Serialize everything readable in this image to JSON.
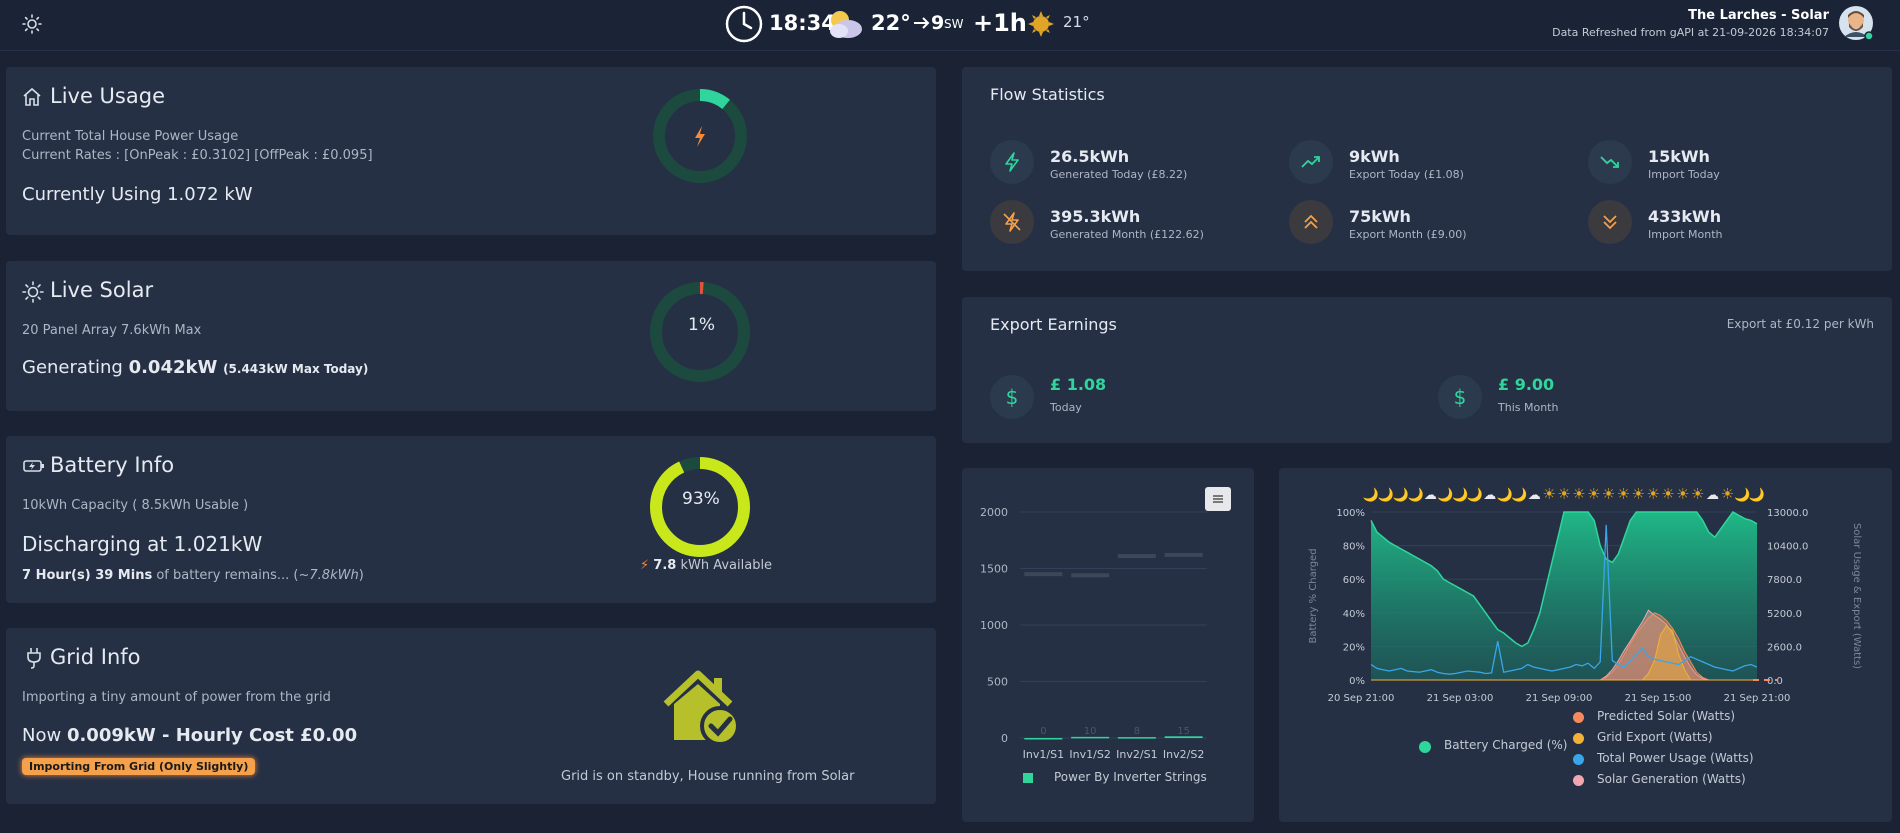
{
  "header": {
    "time": "18:34",
    "temp": "22°",
    "wind_speed": "9",
    "wind_dir": "SW",
    "hour_offset": "+1h",
    "sun_temp": "21°",
    "site_name": "The Larches - Solar",
    "refresh_text": "Data Refreshed from gAPI at 21-09-2026 18:34:07"
  },
  "icons": [
    "sun-icon",
    "clock-icon",
    "cloud-night-icon",
    "arrow-right-icon",
    "sun-weather-icon",
    "avatar",
    "home-icon",
    "solar-icon",
    "battery-icon",
    "plug-icon",
    "bolt-icon",
    "trend-up-icon",
    "trend-down-icon",
    "bolt-off-icon",
    "double-up-icon",
    "double-down-icon",
    "dollar-icon",
    "menu-icon",
    "house-check-icon"
  ],
  "live_usage": {
    "title": "Live Usage",
    "desc": "Current Total House Power Usage",
    "rates": "Current Rates : [OnPeak : £0.3102] [OffPeak : £0.095]",
    "current": "Currently Using 1.072 kW",
    "gauge_fraction": 0.11
  },
  "live_solar": {
    "title": "Live Solar",
    "desc": "20 Panel Array 7.6kWh Max",
    "gen_prefix": "Generating",
    "gen_value": "0.042kW",
    "gen_max": "(5.443kW Max Today)",
    "gauge_label": "1%",
    "gauge_fraction": 0.01
  },
  "battery": {
    "title": "Battery Info",
    "capacity": "10kWh Capacity ( 8.5kWh Usable )",
    "status": "Discharging at 1.021kW",
    "remain_bold": "7 Hour(s) 39 Mins",
    "remain_rest": "of battery remains... (~",
    "remain_est": "7.8kWh",
    "remain_close": ")",
    "gauge_label": "93%",
    "gauge_fraction": 0.93,
    "available_value": "7.8",
    "available_label": "kWh Available"
  },
  "grid": {
    "title": "Grid Info",
    "desc": "Importing a tiny amount of power from the grid",
    "now_prefix": "Now",
    "now_value": "0.009kW - Hourly Cost £0.00",
    "badge": "Importing From Grid (Only Slightly)",
    "status": "Grid is on standby, House running from Solar"
  },
  "flow": {
    "title": "Flow Statistics",
    "items": [
      {
        "value": "26.5kWh",
        "label": "Generated Today (£8.22)"
      },
      {
        "value": "9kWh",
        "label": "Export Today (£1.08)"
      },
      {
        "value": "15kWh",
        "label": "Import Today"
      },
      {
        "value": "395.3kWh",
        "label": "Generated Month (£122.62)"
      },
      {
        "value": "75kWh",
        "label": "Export Month (£9.00)"
      },
      {
        "value": "433kWh",
        "label": "Import Month"
      }
    ]
  },
  "export": {
    "title": "Export Earnings",
    "rate": "Export at £0.12 per kWh",
    "today_value": "£ 1.08",
    "today_label": "Today",
    "month_value": "£ 9.00",
    "month_label": "This Month"
  },
  "chart_data": [
    {
      "type": "bar",
      "categories": [
        "Inv1/S1",
        "Inv1/S2",
        "Inv2/S1",
        "Inv2/S2"
      ],
      "values": [
        0,
        10,
        8,
        15
      ],
      "data_labels": [
        "0",
        "10",
        "8",
        "15"
      ],
      "ghost_values": [
        1450,
        1440,
        1610,
        1620
      ],
      "yticks": [
        "0",
        "500",
        "1000",
        "1500",
        "2000"
      ],
      "ylim": [
        0,
        2000
      ],
      "legend": "Power By Inverter Strings",
      "colors": {
        "bar": "#2fd59b"
      }
    },
    {
      "type": "area",
      "xticks": [
        "20 Sep 21:00",
        "21 Sep 03:00",
        "21 Sep 09:00",
        "21 Sep 15:00",
        "21 Sep 21:00"
      ],
      "yticks_left": [
        "0%",
        "20%",
        "40%",
        "60%",
        "80%",
        "100%"
      ],
      "yticks_right": [
        "0.0",
        "2600.0",
        "5200.0",
        "7800.0",
        "10400.0",
        "13000.0"
      ],
      "ylabel_left": "Battery % Charged",
      "ylabel_right": "Solar Usage & Export (Watts)",
      "weather_icons": [
        "🌙",
        "🌙",
        "🌙",
        "🌙",
        "☁",
        "🌙",
        "🌙",
        "🌙",
        "☁",
        "🌙",
        "🌙",
        "☁",
        "☀",
        "☀",
        "☀",
        "☀",
        "☀",
        "☀",
        "☀",
        "☀",
        "☀",
        "☀",
        "☀",
        "☁",
        "☀",
        "🌙",
        "🌙"
      ],
      "series": [
        {
          "name": "Battery Charged (%)",
          "color": "#2fd59b",
          "values": [
            95,
            88,
            85,
            82,
            80,
            78,
            76,
            74,
            72,
            70,
            68,
            65,
            60,
            58,
            56,
            54,
            52,
            50,
            45,
            40,
            35,
            30,
            28,
            25,
            22,
            20,
            22,
            30,
            40,
            55,
            70,
            85,
            100,
            100,
            100,
            100,
            100,
            95,
            80,
            72,
            70,
            75,
            85,
            95,
            100,
            100,
            100,
            100,
            100,
            100,
            100,
            100,
            100,
            100,
            100,
            95,
            88,
            85,
            90,
            95,
            100,
            98,
            96,
            95,
            93
          ]
        },
        {
          "name": "Predicted Solar (Watts)",
          "color": "#f58a5e",
          "values": [
            0,
            0,
            0,
            0,
            0,
            0,
            0,
            0,
            0,
            0,
            0,
            0,
            0,
            0,
            0,
            0,
            0,
            0,
            0,
            0,
            0,
            0,
            0,
            0,
            0,
            0,
            0,
            0,
            0,
            0,
            0,
            0,
            0,
            0,
            0,
            0,
            0,
            0,
            0,
            200,
            600,
            1200,
            2000,
            2800,
            3600,
            4200,
            4800,
            5200,
            5000,
            4600,
            4000,
            3200,
            2200,
            1400,
            600,
            200,
            0,
            0,
            0,
            0,
            0,
            0,
            0,
            0,
            0
          ]
        },
        {
          "name": "Grid Export (Watts)",
          "color": "#f2b234",
          "values": [
            0,
            0,
            0,
            0,
            0,
            0,
            0,
            0,
            0,
            0,
            0,
            0,
            0,
            0,
            0,
            0,
            0,
            0,
            0,
            0,
            0,
            0,
            0,
            0,
            0,
            0,
            0,
            0,
            0,
            0,
            0,
            0,
            0,
            0,
            0,
            0,
            0,
            0,
            0,
            0,
            0,
            0,
            0,
            0,
            0,
            0,
            500,
            1500,
            3500,
            4200,
            3800,
            2000,
            800,
            0,
            0,
            0,
            0,
            0,
            0,
            0,
            0,
            0,
            0,
            0,
            0
          ]
        },
        {
          "name": "Total Power Usage (Watts)",
          "color": "#3aa6e8",
          "values": [
            1200,
            900,
            800,
            700,
            800,
            900,
            700,
            650,
            600,
            700,
            800,
            600,
            500,
            450,
            500,
            600,
            700,
            650,
            600,
            500,
            550,
            3000,
            600,
            700,
            800,
            900,
            1200,
            1000,
            900,
            800,
            700,
            800,
            900,
            1000,
            1200,
            1100,
            1300,
            900,
            1400,
            12000,
            1500,
            1200,
            1000,
            1500,
            2000,
            2500,
            1800,
            1600,
            1500,
            1400,
            1300,
            1200,
            1500,
            1800,
            1600,
            1400,
            1200,
            1000,
            900,
            800,
            700,
            900,
            1100,
            1200,
            1000
          ]
        },
        {
          "name": "Solar Generation (Watts)",
          "color": "#f4a6b0",
          "values": [
            0,
            0,
            0,
            0,
            0,
            0,
            0,
            0,
            0,
            0,
            0,
            0,
            0,
            0,
            0,
            0,
            0,
            0,
            0,
            0,
            0,
            0,
            0,
            0,
            0,
            0,
            0,
            0,
            0,
            0,
            0,
            0,
            0,
            0,
            0,
            0,
            0,
            0,
            0,
            300,
            800,
            1500,
            2300,
            3000,
            3800,
            4500,
            5400,
            5000,
            4700,
            4300,
            3600,
            2700,
            1800,
            1000,
            400,
            100,
            0,
            0,
            0,
            0,
            0,
            0,
            0,
            0,
            0
          ]
        }
      ]
    }
  ]
}
